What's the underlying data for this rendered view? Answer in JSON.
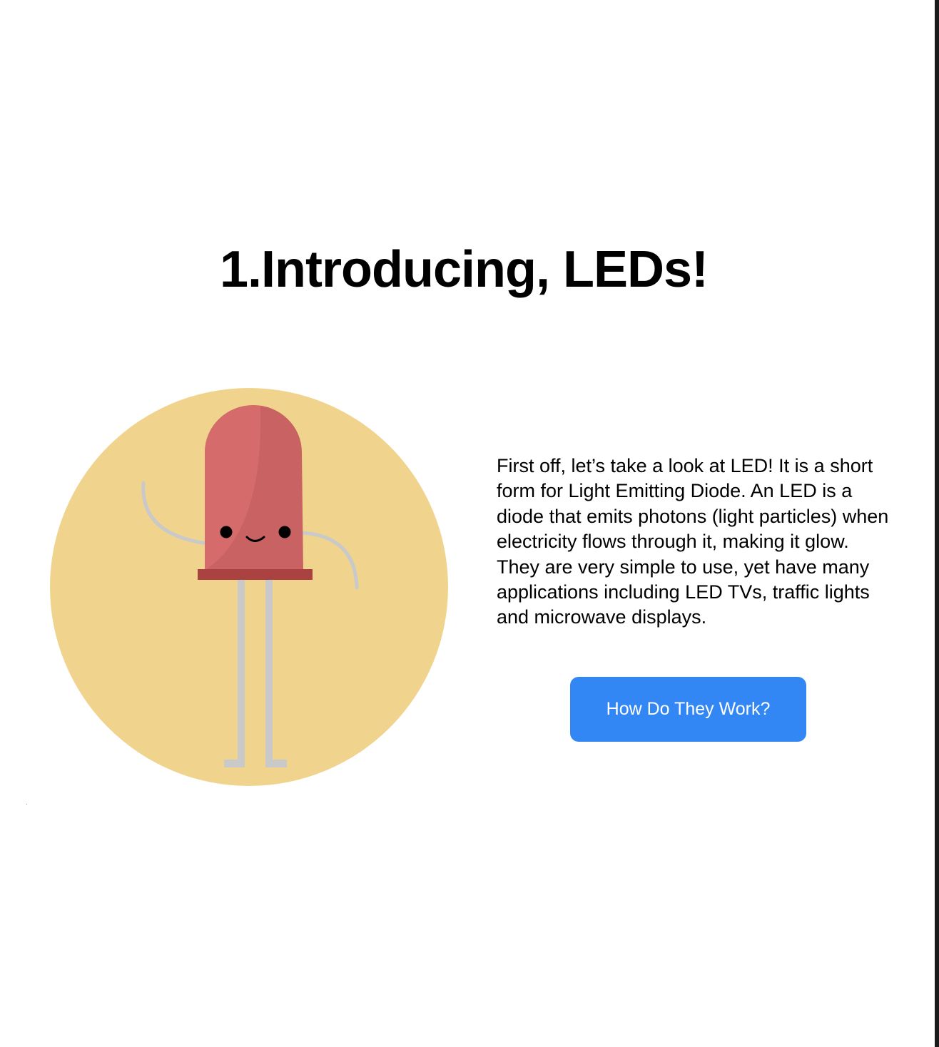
{
  "page": {
    "title": "1.Introducing, LEDs!"
  },
  "intro": {
    "text": "First off, let’s take a look at LED! It is a short form for Light Emitting Diode. An LED is a diode that emits photons (light particles) when electricity flows through it, making it glow. They are very simple to use, yet have many applications including LED TVs, traffic lights and microwave displays."
  },
  "cta": {
    "label": "How Do They Work?"
  },
  "illustration": {
    "icon": "led-character-illustration",
    "colors": {
      "circle": "#f0d48e",
      "bulb": "#c96262",
      "bulb_highlight": "#d56b6b",
      "base": "#aa4242",
      "legs": "#c9c9c9",
      "face": "#000000"
    }
  },
  "colors": {
    "button": "#3287f5",
    "button_text": "#ffffff",
    "text": "#000000",
    "background": "#ffffff"
  }
}
